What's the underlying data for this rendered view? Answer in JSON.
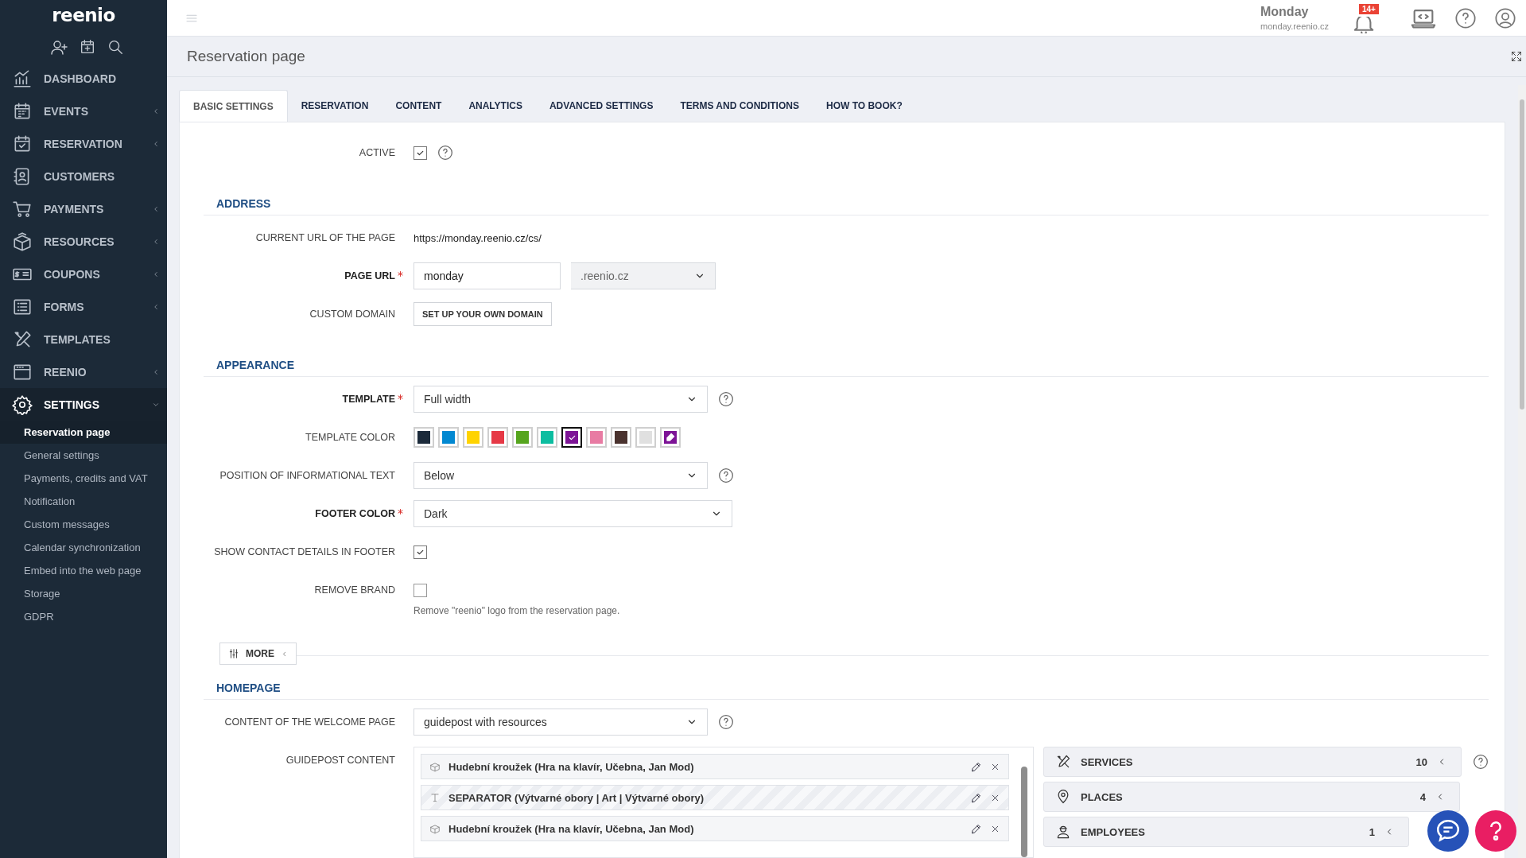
{
  "sidebar": {
    "logo": "reenio",
    "items": [
      {
        "kind": "link",
        "label": "DASHBOARD",
        "expanded": false,
        "selected": false
      },
      {
        "kind": "group",
        "label": "EVENTS",
        "expanded": false,
        "selected": false
      },
      {
        "kind": "group",
        "label": "RESERVATION",
        "expanded": false,
        "selected": false
      },
      {
        "kind": "link",
        "label": "CUSTOMERS",
        "expanded": false,
        "selected": false
      },
      {
        "kind": "group",
        "label": "PAYMENTS",
        "expanded": false,
        "selected": false
      },
      {
        "kind": "group",
        "label": "RESOURCES",
        "expanded": false,
        "selected": false
      },
      {
        "kind": "group",
        "label": "COUPONS",
        "expanded": false,
        "selected": false
      },
      {
        "kind": "group",
        "label": "FORMS",
        "expanded": false,
        "selected": false
      },
      {
        "kind": "link",
        "label": "TEMPLATES",
        "expanded": false,
        "selected": false
      },
      {
        "kind": "group",
        "label": "REENIO",
        "expanded": false,
        "selected": false
      },
      {
        "kind": "group",
        "label": "SETTINGS",
        "expanded": true,
        "selected": true,
        "children": [
          {
            "label": "Reservation page",
            "selected": true
          },
          {
            "label": "General settings",
            "selected": false
          },
          {
            "label": "Payments, credits and VAT",
            "selected": false
          },
          {
            "label": "Notification",
            "selected": false
          },
          {
            "label": "Custom messages",
            "selected": false
          },
          {
            "label": "Calendar synchronization",
            "selected": false
          },
          {
            "label": "Embed into the web page",
            "selected": false
          },
          {
            "label": "Storage",
            "selected": false
          },
          {
            "label": "GDPR",
            "selected": false
          }
        ]
      }
    ]
  },
  "topbar": {
    "account_name": "Monday",
    "account_domain": "monday.reenio.cz",
    "notifications_badge": "14+"
  },
  "page": {
    "title": "Reservation page"
  },
  "tabs": [
    {
      "label": "BASIC SETTINGS",
      "selected": true
    },
    {
      "label": "RESERVATION",
      "selected": false
    },
    {
      "label": "CONTENT",
      "selected": false
    },
    {
      "label": "ANALYTICS",
      "selected": false
    },
    {
      "label": "ADVANCED SETTINGS",
      "selected": false
    },
    {
      "label": "TERMS AND CONDITIONS",
      "selected": false
    },
    {
      "label": "HOW TO BOOK?",
      "selected": false
    }
  ],
  "sections": [
    {
      "rows": [
        {
          "kind": "checkbox",
          "label": "ACTIVE",
          "required": false,
          "checked": true,
          "help": true
        }
      ]
    },
    {
      "heading": "ADDRESS",
      "rows": [
        {
          "kind": "text",
          "label": "CURRENT URL OF THE PAGE",
          "required": false,
          "value": "https://monday.reenio.cz/cs/"
        },
        {
          "kind": "input_select",
          "label": "PAGE URL",
          "required": true,
          "value": "monday",
          "select": ".reenio.cz"
        },
        {
          "kind": "button",
          "label": "CUSTOM DOMAIN",
          "required": false,
          "button": "SET UP YOUR OWN DOMAIN"
        }
      ]
    },
    {
      "heading": "APPEARANCE",
      "more_button": {
        "label": "MORE",
        "expanded": false
      },
      "rows": [
        {
          "kind": "select",
          "label": "TEMPLATE",
          "required": true,
          "value": "Full width",
          "help": true
        },
        {
          "kind": "swatches",
          "label": "TEMPLATE COLOR",
          "required": false,
          "colors": [
            {
              "color": "#1b2a3a",
              "selected": false
            },
            {
              "color": "#0288d1",
              "selected": false
            },
            {
              "color": "#ffd300",
              "selected": false
            },
            {
              "color": "#e63946",
              "selected": false
            },
            {
              "color": "#56a51e",
              "selected": false
            },
            {
              "color": "#0cbda0",
              "selected": false
            },
            {
              "color": "#7d1496",
              "selected": true
            },
            {
              "color": "#e87ba3",
              "selected": false
            },
            {
              "color": "#4a322e",
              "selected": false
            },
            {
              "color": "#e0e0e0",
              "selected": false
            },
            {
              "color": "#7d1496",
              "selected": false,
              "kind": "picker"
            }
          ]
        },
        {
          "kind": "select",
          "label": "POSITION OF INFORMATIONAL TEXT",
          "required": false,
          "value": "Below",
          "help": true
        },
        {
          "kind": "select",
          "label": "FOOTER COLOR",
          "required": true,
          "value": "Dark",
          "help": false
        },
        {
          "kind": "checkbox",
          "label": "SHOW CONTACT DETAILS IN FOOTER",
          "required": false,
          "checked": true
        },
        {
          "kind": "checkbox",
          "label": "REMOVE BRAND",
          "required": false,
          "checked": false,
          "note": "Remove \"reenio\" logo from the reservation page."
        }
      ]
    },
    {
      "heading": "HOMEPAGE",
      "rows": [
        {
          "kind": "select",
          "label": "CONTENT OF THE WELCOME PAGE",
          "required": false,
          "value": "guidepost with resources",
          "help": true
        },
        {
          "kind": "guidepost",
          "label": "GUIDEPOST CONTENT",
          "required": false,
          "items": [
            {
              "kind": "resource",
              "text": "Hudební kroužek (Hra na klavír, Učebna, Jan Mod)"
            },
            {
              "kind": "separator",
              "text": "SEPARATOR (Výtvarné obory | Art | Výtvarné obory)"
            },
            {
              "kind": "resource",
              "text": "Hudební kroužek (Hra na klavír, Učebna, Jan Mod)"
            }
          ],
          "categories": [
            {
              "label": "SERVICES",
              "count": "10"
            },
            {
              "label": "PLACES",
              "count": "4"
            },
            {
              "label": "EMPLOYEES",
              "count": "1"
            }
          ]
        }
      ]
    }
  ]
}
